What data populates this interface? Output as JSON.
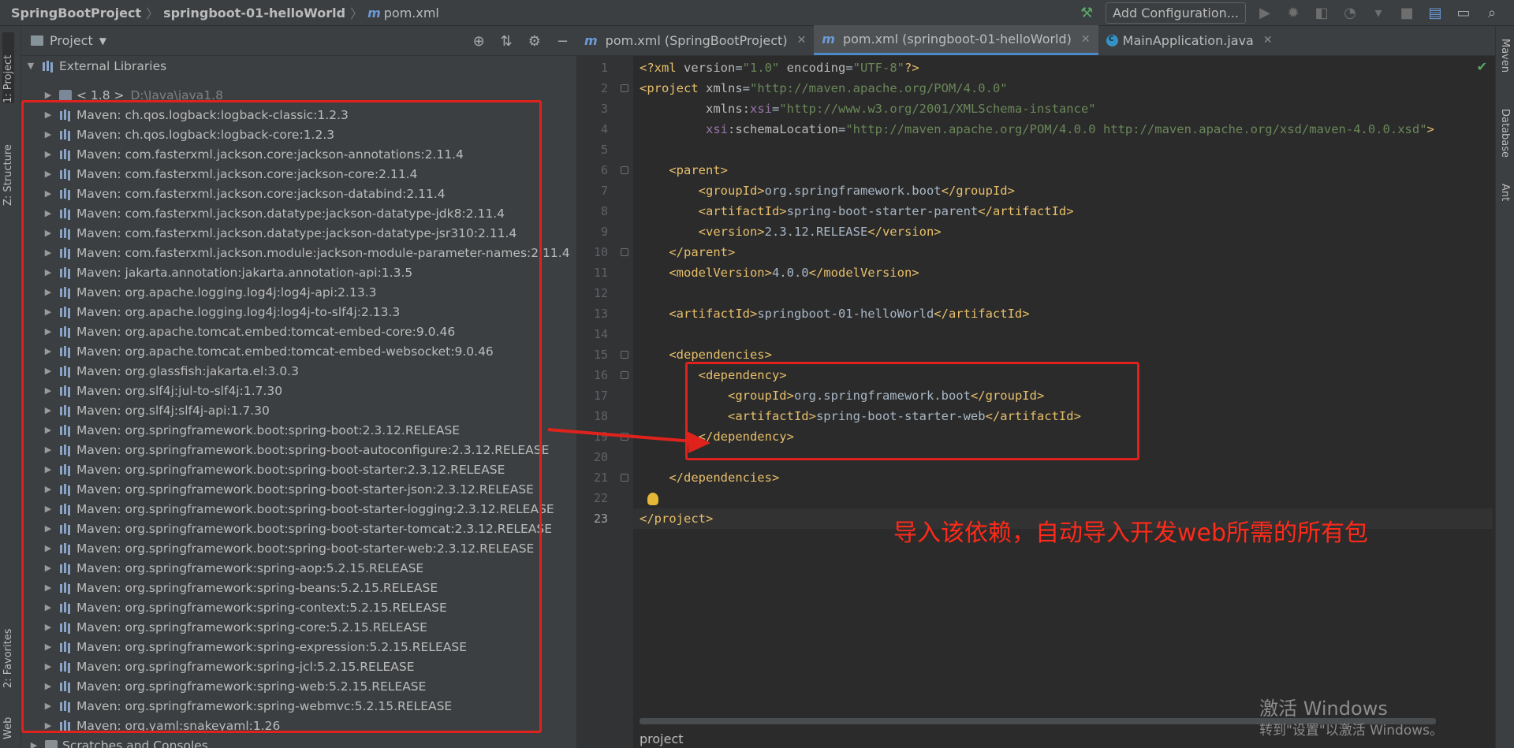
{
  "navbar": {
    "crumbs": [
      "SpringBootProject",
      "springboot-01-helloWorld",
      "pom.xml"
    ],
    "file_icon": "m",
    "add_config_label": "Add Configuration..."
  },
  "left_strip": {
    "tabs": [
      "1: Project",
      "Z: Structure",
      "2: Favorites",
      "Web"
    ]
  },
  "right_strip": {
    "tabs": [
      "Maven",
      "Database",
      "Ant"
    ]
  },
  "project_panel": {
    "title": "Project",
    "tree": [
      {
        "label": "External Libraries",
        "level": 0,
        "expanded": true,
        "kind": "lib-root"
      },
      {
        "label": "< 1.8 >",
        "extra": "D:\\Java\\java1.8",
        "level": 1,
        "kind": "jdk"
      },
      {
        "label": "Maven: ch.qos.logback:logback-classic:1.2.3",
        "level": 1,
        "kind": "lib"
      },
      {
        "label": "Maven: ch.qos.logback:logback-core:1.2.3",
        "level": 1,
        "kind": "lib"
      },
      {
        "label": "Maven: com.fasterxml.jackson.core:jackson-annotations:2.11.4",
        "level": 1,
        "kind": "lib"
      },
      {
        "label": "Maven: com.fasterxml.jackson.core:jackson-core:2.11.4",
        "level": 1,
        "kind": "lib"
      },
      {
        "label": "Maven: com.fasterxml.jackson.core:jackson-databind:2.11.4",
        "level": 1,
        "kind": "lib"
      },
      {
        "label": "Maven: com.fasterxml.jackson.datatype:jackson-datatype-jdk8:2.11.4",
        "level": 1,
        "kind": "lib"
      },
      {
        "label": "Maven: com.fasterxml.jackson.datatype:jackson-datatype-jsr310:2.11.4",
        "level": 1,
        "kind": "lib"
      },
      {
        "label": "Maven: com.fasterxml.jackson.module:jackson-module-parameter-names:2.11.4",
        "level": 1,
        "kind": "lib"
      },
      {
        "label": "Maven: jakarta.annotation:jakarta.annotation-api:1.3.5",
        "level": 1,
        "kind": "lib"
      },
      {
        "label": "Maven: org.apache.logging.log4j:log4j-api:2.13.3",
        "level": 1,
        "kind": "lib"
      },
      {
        "label": "Maven: org.apache.logging.log4j:log4j-to-slf4j:2.13.3",
        "level": 1,
        "kind": "lib"
      },
      {
        "label": "Maven: org.apache.tomcat.embed:tomcat-embed-core:9.0.46",
        "level": 1,
        "kind": "lib"
      },
      {
        "label": "Maven: org.apache.tomcat.embed:tomcat-embed-websocket:9.0.46",
        "level": 1,
        "kind": "lib"
      },
      {
        "label": "Maven: org.glassfish:jakarta.el:3.0.3",
        "level": 1,
        "kind": "lib"
      },
      {
        "label": "Maven: org.slf4j:jul-to-slf4j:1.7.30",
        "level": 1,
        "kind": "lib"
      },
      {
        "label": "Maven: org.slf4j:slf4j-api:1.7.30",
        "level": 1,
        "kind": "lib"
      },
      {
        "label": "Maven: org.springframework.boot:spring-boot:2.3.12.RELEASE",
        "level": 1,
        "kind": "lib"
      },
      {
        "label": "Maven: org.springframework.boot:spring-boot-autoconfigure:2.3.12.RELEASE",
        "level": 1,
        "kind": "lib"
      },
      {
        "label": "Maven: org.springframework.boot:spring-boot-starter:2.3.12.RELEASE",
        "level": 1,
        "kind": "lib"
      },
      {
        "label": "Maven: org.springframework.boot:spring-boot-starter-json:2.3.12.RELEASE",
        "level": 1,
        "kind": "lib"
      },
      {
        "label": "Maven: org.springframework.boot:spring-boot-starter-logging:2.3.12.RELEASE",
        "level": 1,
        "kind": "lib"
      },
      {
        "label": "Maven: org.springframework.boot:spring-boot-starter-tomcat:2.3.12.RELEASE",
        "level": 1,
        "kind": "lib"
      },
      {
        "label": "Maven: org.springframework.boot:spring-boot-starter-web:2.3.12.RELEASE",
        "level": 1,
        "kind": "lib"
      },
      {
        "label": "Maven: org.springframework:spring-aop:5.2.15.RELEASE",
        "level": 1,
        "kind": "lib"
      },
      {
        "label": "Maven: org.springframework:spring-beans:5.2.15.RELEASE",
        "level": 1,
        "kind": "lib"
      },
      {
        "label": "Maven: org.springframework:spring-context:5.2.15.RELEASE",
        "level": 1,
        "kind": "lib"
      },
      {
        "label": "Maven: org.springframework:spring-core:5.2.15.RELEASE",
        "level": 1,
        "kind": "lib"
      },
      {
        "label": "Maven: org.springframework:spring-expression:5.2.15.RELEASE",
        "level": 1,
        "kind": "lib"
      },
      {
        "label": "Maven: org.springframework:spring-jcl:5.2.15.RELEASE",
        "level": 1,
        "kind": "lib"
      },
      {
        "label": "Maven: org.springframework:spring-web:5.2.15.RELEASE",
        "level": 1,
        "kind": "lib"
      },
      {
        "label": "Maven: org.springframework:spring-webmvc:5.2.15.RELEASE",
        "level": 1,
        "kind": "lib"
      },
      {
        "label": "Maven: org.yaml:snakeyaml:1.26",
        "level": 1,
        "kind": "lib"
      },
      {
        "label": "Scratches and Consoles",
        "level": 0,
        "kind": "scratch"
      }
    ]
  },
  "editor": {
    "tabs": [
      {
        "label": "pom.xml (SpringBootProject)",
        "icon": "m",
        "active": false
      },
      {
        "label": "pom.xml (springboot-01-helloWorld)",
        "icon": "m",
        "active": true
      },
      {
        "label": "MainApplication.java",
        "icon": "c",
        "active": false
      }
    ],
    "current_line": 23,
    "lines": [
      [
        [
          "p",
          "<?"
        ],
        [
          "t",
          "xml "
        ],
        [
          "a",
          "version"
        ],
        [
          "c",
          "="
        ],
        [
          "v",
          "\"1.0\" "
        ],
        [
          "a",
          "encoding"
        ],
        [
          "c",
          "="
        ],
        [
          "v",
          "\"UTF-8\""
        ],
        [
          "p",
          "?>"
        ]
      ],
      [
        [
          "t",
          "<project "
        ],
        [
          "a",
          "xmlns"
        ],
        [
          "c",
          "="
        ],
        [
          "v",
          "\"http://maven.apache.org/POM/4.0.0\""
        ]
      ],
      [
        [
          "c",
          "         "
        ],
        [
          "a",
          "xmlns:"
        ],
        [
          "ns",
          "xsi"
        ],
        [
          "c",
          "="
        ],
        [
          "v",
          "\"http://www.w3.org/2001/XMLSchema-instance\""
        ]
      ],
      [
        [
          "c",
          "         "
        ],
        [
          "ns",
          "xsi"
        ],
        [
          "a",
          ":schemaLocation"
        ],
        [
          "c",
          "="
        ],
        [
          "v",
          "\"http://maven.apache.org/POM/4.0.0 http://maven.apache.org/xsd/maven-4.0.0.xsd\""
        ],
        [
          "t",
          ">"
        ]
      ],
      [],
      [
        [
          "c",
          "    "
        ],
        [
          "t",
          "<parent>"
        ]
      ],
      [
        [
          "c",
          "        "
        ],
        [
          "t",
          "<groupId>"
        ],
        [
          "c",
          "org.springframework.boot"
        ],
        [
          "t",
          "</groupId>"
        ]
      ],
      [
        [
          "c",
          "        "
        ],
        [
          "t",
          "<artifactId>"
        ],
        [
          "c",
          "spring-boot-starter-parent"
        ],
        [
          "t",
          "</artifactId>"
        ]
      ],
      [
        [
          "c",
          "        "
        ],
        [
          "t",
          "<version>"
        ],
        [
          "c",
          "2.3.12.RELEASE"
        ],
        [
          "t",
          "</version>"
        ]
      ],
      [
        [
          "c",
          "    "
        ],
        [
          "t",
          "</parent>"
        ]
      ],
      [
        [
          "c",
          "    "
        ],
        [
          "t",
          "<modelVersion>"
        ],
        [
          "c",
          "4.0.0"
        ],
        [
          "t",
          "</modelVersion>"
        ]
      ],
      [],
      [
        [
          "c",
          "    "
        ],
        [
          "t",
          "<artifactId>"
        ],
        [
          "c",
          "springboot-01-helloWorld"
        ],
        [
          "t",
          "</artifactId>"
        ]
      ],
      [],
      [
        [
          "c",
          "    "
        ],
        [
          "t",
          "<dependencies>"
        ]
      ],
      [
        [
          "c",
          "        "
        ],
        [
          "t",
          "<dependency>"
        ]
      ],
      [
        [
          "c",
          "            "
        ],
        [
          "t",
          "<groupId>"
        ],
        [
          "c",
          "org.springframework.boot"
        ],
        [
          "t",
          "</groupId>"
        ]
      ],
      [
        [
          "c",
          "            "
        ],
        [
          "t",
          "<artifactId>"
        ],
        [
          "c",
          "spring-boot-starter-web"
        ],
        [
          "t",
          "</artifactId>"
        ]
      ],
      [
        [
          "c",
          "        "
        ],
        [
          "t",
          "</dependency>"
        ]
      ],
      [],
      [
        [
          "c",
          "    "
        ],
        [
          "t",
          "</dependencies>"
        ]
      ],
      [],
      [
        [
          "t",
          "</project>"
        ]
      ]
    ],
    "annotation": "导入该依赖，自动导入开发web所需的所有包",
    "bottom_label": "project"
  },
  "watermark": {
    "line1": "激活 Windows",
    "line2": "转到\"设置\"以激活 Windows。"
  },
  "colors": {
    "annotation_red": "#e0221c",
    "tag": "#e8bf6a",
    "attr_value": "#6a8759",
    "namespace": "#9876aa"
  }
}
